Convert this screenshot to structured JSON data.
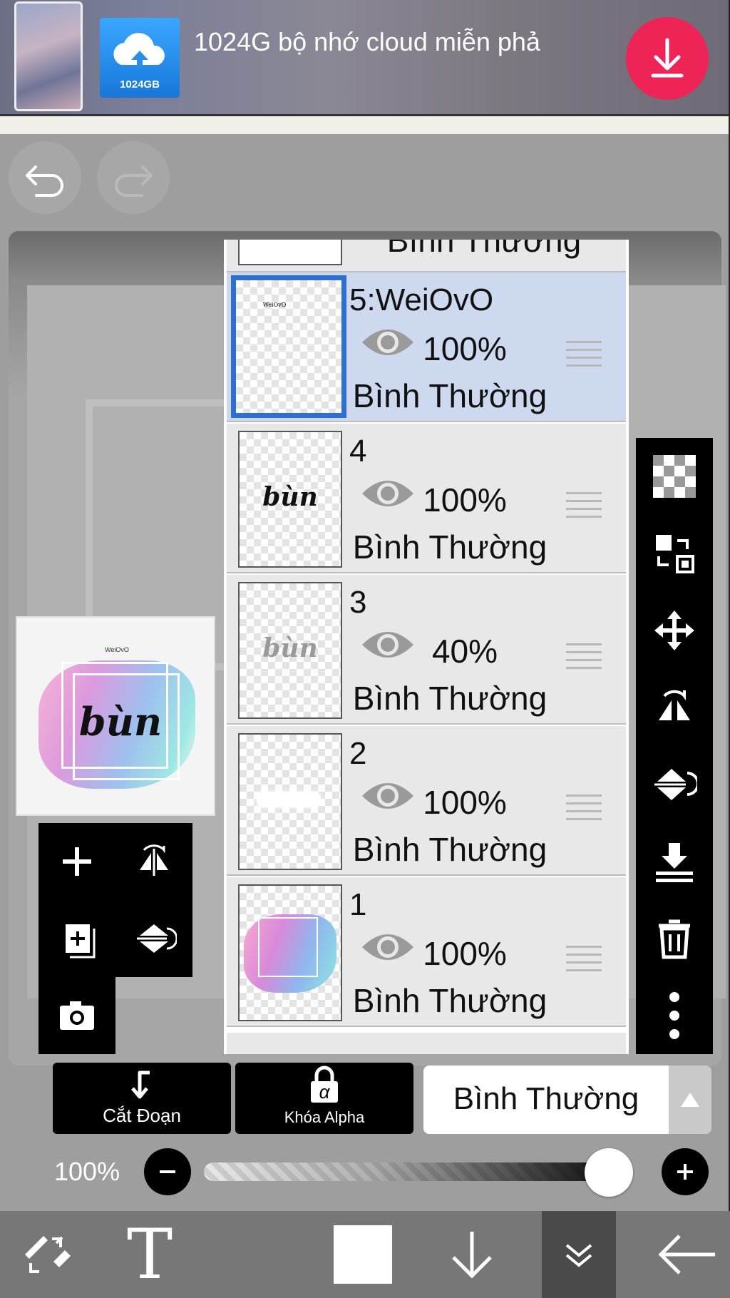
{
  "ad_banner": {
    "text": "1024G bộ nhớ cloud miễn phả",
    "cloud_label": "1024GB"
  },
  "preview": {
    "title": "bùn",
    "small_text": "WeiOvO"
  },
  "layers": {
    "partial_top_mode": "Bình Thường",
    "rows": [
      {
        "name": "5:WeiOvO",
        "opacity": "100%",
        "mode": "Bình Thường",
        "selected": true,
        "thumb_text": "WeiOvO"
      },
      {
        "name": "4",
        "opacity": "100%",
        "mode": "Bình Thường",
        "selected": false,
        "thumb_text": "bùn"
      },
      {
        "name": "3",
        "opacity": "40%",
        "mode": "Bình Thường",
        "selected": false,
        "thumb_text": "bùn"
      },
      {
        "name": "2",
        "opacity": "100%",
        "mode": "Bình Thường",
        "selected": false,
        "thumb_text": ""
      },
      {
        "name": "1",
        "opacity": "100%",
        "mode": "Bình Thường",
        "selected": false,
        "thumb_text": ""
      }
    ]
  },
  "controls": {
    "clip_label": "Cắt Đoạn",
    "alpha_lock_label": "Khóa Alpha",
    "alpha_symbol": "α",
    "blend_mode": "Bình Thường",
    "opacity_text": "100%",
    "opacity_value": 1.0
  },
  "bottom_nav": {
    "text_tool_label": "T"
  },
  "colors": {
    "selected_layer_bg": "#cdd9ee",
    "selected_layer_border": "#2e6fd1",
    "ad_download": "#ee2457"
  },
  "icons": [
    "undo-icon",
    "redo-icon",
    "add-layer-icon",
    "flip-horizontal-icon",
    "copy-layer-icon",
    "flip-vertical-icon",
    "camera-icon",
    "transparent-icon",
    "reference-icon",
    "move-icon",
    "flip-h-icon",
    "flip-v-icon",
    "merge-down-icon",
    "trash-icon",
    "more-icon",
    "eye-icon",
    "drag-handle-icon",
    "transform-tool-icon",
    "text-tool-icon",
    "arrow-down-icon",
    "double-chevron-down-icon",
    "back-arrow-icon"
  ]
}
